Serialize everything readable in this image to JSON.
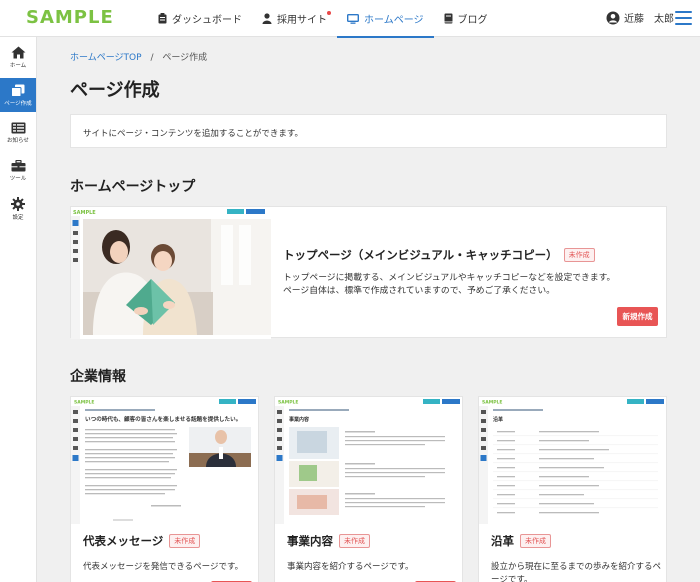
{
  "app": {
    "logo": "SAMPLE"
  },
  "topnav": {
    "items": [
      {
        "label": "ダッシュボード",
        "icon": "clipboard-icon"
      },
      {
        "label": "採用サイト",
        "icon": "person-icon",
        "notification": true
      },
      {
        "label": "ホームページ",
        "icon": "monitor-icon",
        "active": true
      },
      {
        "label": "ブログ",
        "icon": "book-icon"
      }
    ]
  },
  "user": {
    "name": "近藤　太郎"
  },
  "sidebar": {
    "items": [
      {
        "label": "ホーム",
        "icon": "home-icon"
      },
      {
        "label": "ページ作成",
        "icon": "pages-icon",
        "active": true
      },
      {
        "label": "お知らせ",
        "icon": "news-icon"
      },
      {
        "label": "ツール",
        "icon": "toolbox-icon"
      },
      {
        "label": "設定",
        "icon": "gear-icon"
      }
    ]
  },
  "breadcrumb": {
    "home": "ホームページTOP",
    "separator": "/",
    "current": "ページ作成"
  },
  "page": {
    "title": "ページ作成",
    "intro": "サイトにページ・コンテンツを追加することができます。"
  },
  "homepage_top": {
    "heading": "ホームページトップ",
    "card": {
      "title": "トップページ（メインビジュアル・キャッチコピー）",
      "badge": "未作成",
      "desc_line1": "トップページに掲載する、メインビジュアルやキャッチコピーなどを設定できます。",
      "desc_line2": "ページ自体は、標準で作成されていますので、予めご了承ください。",
      "button": "新規作成"
    }
  },
  "company": {
    "heading": "企業情報",
    "cards": [
      {
        "title": "代表メッセージ",
        "badge": "未作成",
        "desc": "代表メッセージを発信できるページです。"
      },
      {
        "title": "事業内容",
        "badge": "未作成",
        "desc": "事業内容を紹介するページです。"
      },
      {
        "title": "沿革",
        "badge": "未作成",
        "desc": "設立から現在に至るまでの歩みを紹介するページです。"
      }
    ]
  },
  "thumb_text": {
    "logo": "SAMPLE",
    "message_headline": "いつの時代も、顧客の皆さんを楽しませる話題を提供したい。",
    "business_header": "事業内容",
    "history_header": "沿革"
  },
  "colors": {
    "accent": "#2c78c8",
    "brand": "#7cc243",
    "danger": "#e85555"
  }
}
